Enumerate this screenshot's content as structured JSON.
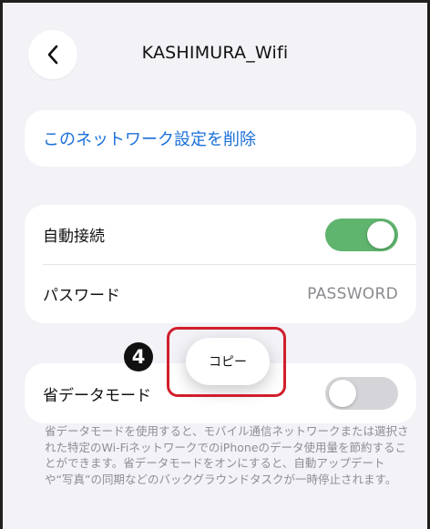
{
  "nav": {
    "title": "KASHIMURA_Wifi"
  },
  "actions": {
    "forget_network": "このネットワーク設定を削除"
  },
  "settings": {
    "auto_join": {
      "label": "自動接続",
      "enabled": true
    },
    "password": {
      "label": "パスワード",
      "value": "PASSWORD"
    }
  },
  "low_data_mode": {
    "label": "省データモード",
    "enabled": false,
    "description": "省データモードを使用すると、モバイル通信ネットワークまたは選択された特定のWi-FiネットワークでのiPhoneのデータ使用量を節約することができます。省データモードをオンにすると、自動アップデートや“写真”の同期などのバックグラウンドタスクが一時停止されます。"
  },
  "popup": {
    "copy_label": "コピー"
  },
  "annotation": {
    "step_number": "4"
  },
  "colors": {
    "link_blue": "#1a6fd9",
    "toggle_on": "#5fb46e",
    "toggle_off": "#d5d5d9",
    "annotation_red": "#d11f2c",
    "background": "#f2f2f7"
  }
}
